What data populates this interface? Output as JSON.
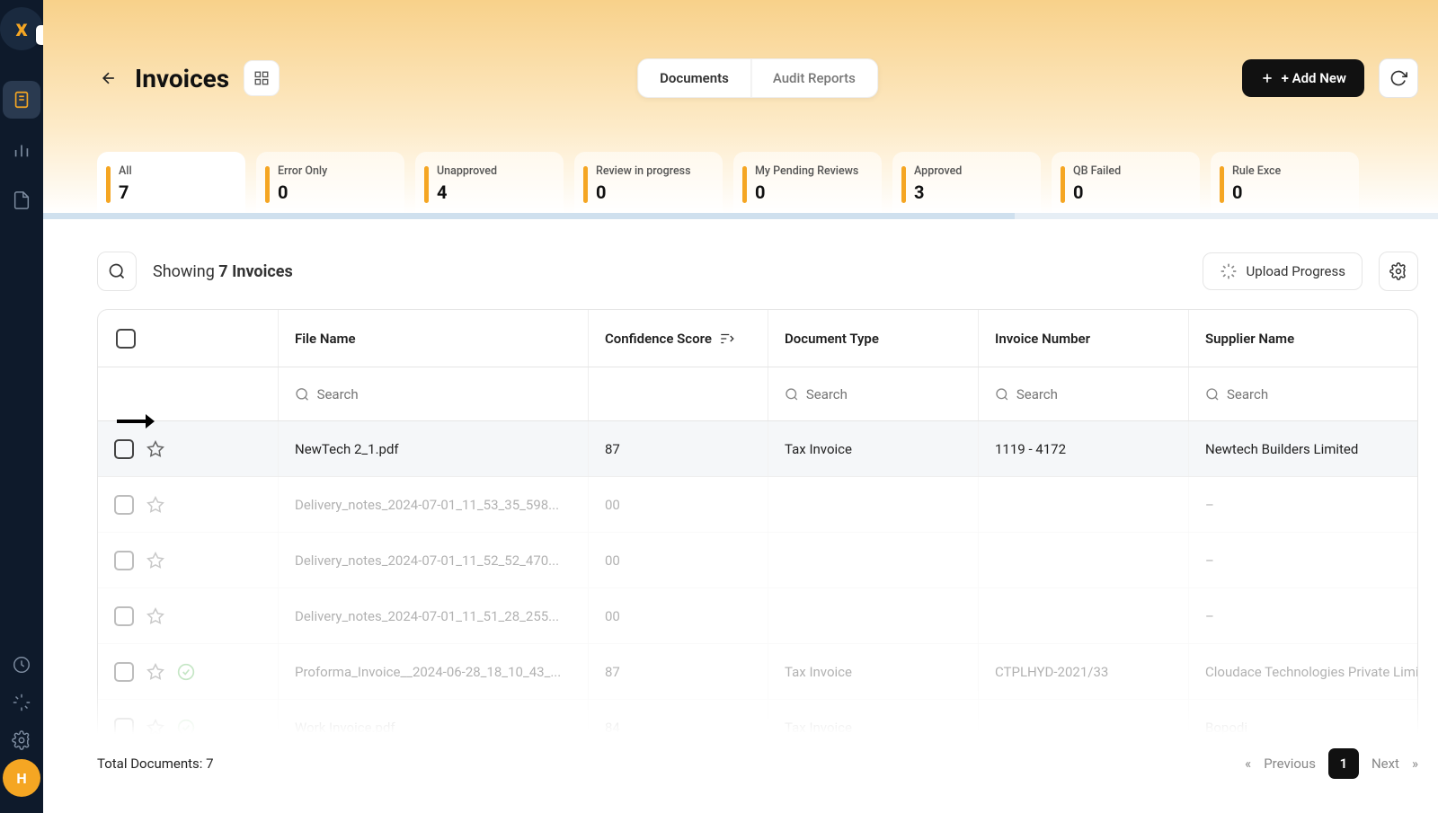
{
  "sidebar": {
    "avatar_initial": "H"
  },
  "header": {
    "title": "Invoices",
    "tabs": [
      "Documents",
      "Audit Reports"
    ],
    "add_label": "+  Add New"
  },
  "filters": [
    {
      "label": "All",
      "value": "7",
      "accent": "#f5a623",
      "active": true
    },
    {
      "label": "Error Only",
      "value": "0",
      "accent": "#f5a623"
    },
    {
      "label": "Unapproved",
      "value": "4",
      "accent": "#f5a623"
    },
    {
      "label": "Review in progress",
      "value": "0",
      "accent": "#f5a623"
    },
    {
      "label": "My Pending Reviews",
      "value": "0",
      "accent": "#f5a623"
    },
    {
      "label": "Approved",
      "value": "3",
      "accent": "#f5a623"
    },
    {
      "label": "QB Failed",
      "value": "0",
      "accent": "#f5a623"
    },
    {
      "label": "Rule Exce",
      "value": "0",
      "accent": "#f5a623"
    }
  ],
  "toolbar": {
    "showing_prefix": "Showing ",
    "showing_bold": "7 Invoices",
    "upload_label": "Upload Progress"
  },
  "table": {
    "columns": [
      "File Name",
      "Confidence Score",
      "Document Type",
      "Invoice Number",
      "Supplier Name"
    ],
    "search_placeholder": "Search",
    "rows": [
      {
        "file": "NewTech 2_1.pdf",
        "score": "87",
        "type": "Tax Invoice",
        "invoice": "1119 - 4172",
        "supplier": "Newtech Builders Limited",
        "highlight": true,
        "approved": false
      },
      {
        "file": "Delivery_notes_2024-07-01_11_53_35_598...",
        "score": "00",
        "type": "",
        "invoice": "",
        "supplier": "–",
        "faded": true,
        "approved": false
      },
      {
        "file": "Delivery_notes_2024-07-01_11_52_52_470...",
        "score": "00",
        "type": "",
        "invoice": "",
        "supplier": "–",
        "faded": true,
        "approved": false
      },
      {
        "file": "Delivery_notes_2024-07-01_11_51_28_255...",
        "score": "00",
        "type": "",
        "invoice": "",
        "supplier": "–",
        "faded": true,
        "approved": false
      },
      {
        "file": "Proforma_Invoice__2024-06-28_18_10_43_...",
        "score": "87",
        "type": "Tax Invoice",
        "invoice": "CTPLHYD-2021/33",
        "supplier": "Cloudace Technologies Private Limited",
        "faded": true,
        "approved": true
      },
      {
        "file": "Work Invoice.pdf",
        "score": "84",
        "type": "Tax Invoice",
        "invoice": "",
        "supplier": "Bopodi",
        "faded": true,
        "approved": true
      }
    ]
  },
  "footer": {
    "total": "Total Documents: 7",
    "prev": "Previous",
    "page": "1",
    "next": "Next"
  }
}
